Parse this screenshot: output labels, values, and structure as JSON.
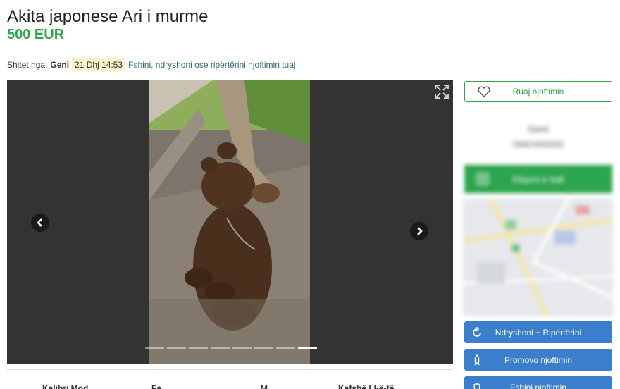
{
  "listing": {
    "title": "Akita japonese Ari i murme",
    "price": "500 EUR"
  },
  "meta": {
    "sold_by_label": "Shitet nga:",
    "seller": "Geni",
    "date": "21 Dhj 14:53",
    "edit_link": "Fshini, ndryshoni ose ripërtërini njoftimin tuaj"
  },
  "gallery": {
    "image_count": 8,
    "active_index": 7
  },
  "sidebar": {
    "save_label": "Ruaj njoftimin",
    "seller_name": "Geni",
    "seller_phone": "0682400000",
    "contact_label": "Kliqoni e ball"
  },
  "actions": {
    "edit_renew": "Ndryshoni + Ripërtërini",
    "promote": "Promovo njoftimin",
    "delete": "Fshini njoftimin"
  },
  "colors": {
    "accent_green": "#2da44e",
    "action_blue": "#3b7fcc"
  },
  "tabs_peek": [
    "Kalibri Mod...",
    "Fa...",
    "M...",
    "Kafshë Ll-ë-të..."
  ]
}
